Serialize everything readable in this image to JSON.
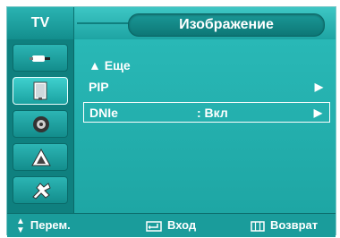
{
  "header": {
    "tv_tab": "TV",
    "title": "Изображение"
  },
  "sidebar": {
    "items": [
      {
        "icon": "antenna-icon"
      },
      {
        "icon": "picture-icon"
      },
      {
        "icon": "speaker-icon"
      },
      {
        "icon": "channel-icon"
      },
      {
        "icon": "setup-icon"
      }
    ]
  },
  "menu": {
    "items": [
      {
        "label": "▲ Еще",
        "value": "",
        "arrow": ""
      },
      {
        "label": "PIP",
        "value": "",
        "arrow": "▶"
      },
      {
        "label": "DNIe",
        "value": ":  Вкл",
        "arrow": "▶"
      }
    ]
  },
  "footer": {
    "move": "Перем.",
    "enter": "Вход",
    "return": "Возврат"
  },
  "colors": {
    "accent": "#1ea6a4",
    "header": "#3dc6c4",
    "sidebar": "#0f807f",
    "text": "#ffffff"
  }
}
